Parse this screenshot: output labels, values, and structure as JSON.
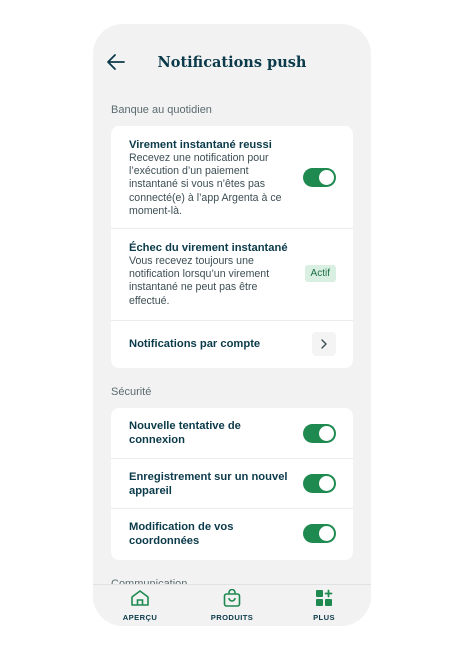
{
  "header": {
    "title": "Notifications push",
    "back_icon": "arrow-left-icon"
  },
  "sections": {
    "daily": {
      "label": "Banque au quotidien",
      "items": [
        {
          "title": "Virement instantané reussi",
          "description": "Recevez une notification pour l’exécution d’un paiement instantané si vous n’êtes pas connecté(e) à l’app Argenta à ce moment-là.",
          "control": "toggle",
          "enabled": true
        },
        {
          "title": "Échec du virement instantané",
          "description": "Vous recevez toujours une notification lorsqu’un virement instantané ne peut pas être effectué.",
          "control": "badge",
          "badge": "Actif"
        },
        {
          "title": "Notifications par compte",
          "control": "chevron",
          "icon": "chevron-right-icon"
        }
      ]
    },
    "security": {
      "label": "Sécurité",
      "items": [
        {
          "title": "Nouvelle tentative de connexion",
          "control": "toggle",
          "enabled": true
        },
        {
          "title": "Enregistrement sur un nouvel appareil",
          "control": "toggle",
          "enabled": true
        },
        {
          "title": "Modification de vos coordonnées",
          "control": "toggle",
          "enabled": true
        }
      ]
    },
    "next_partial_label": "Communication"
  },
  "tabbar": {
    "tabs": [
      {
        "label": "APERÇU",
        "icon": "home-icon"
      },
      {
        "label": "PRODUITS",
        "icon": "shopping-bag-icon"
      },
      {
        "label": "PLUS",
        "icon": "grid-plus-icon"
      }
    ]
  },
  "colors": {
    "background": "#f2f2f2",
    "card": "#ffffff",
    "primary_text": "#0b3a4a",
    "toggle_on": "#1e8a4f",
    "badge_bg": "#d9efe2",
    "badge_text": "#1c6e42"
  }
}
